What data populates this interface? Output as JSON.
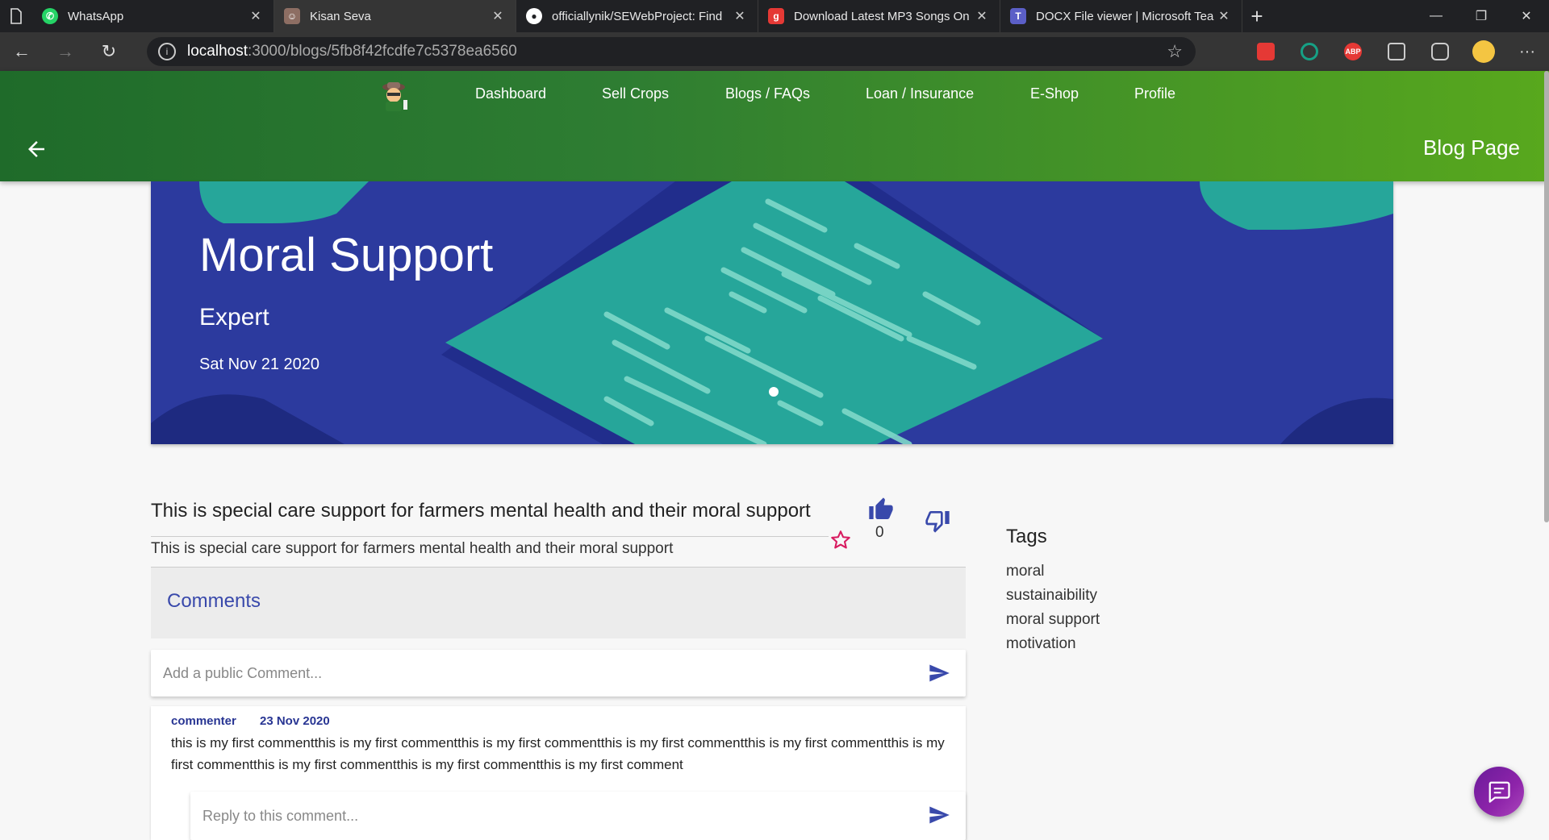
{
  "browser": {
    "tabs": [
      {
        "title": "WhatsApp",
        "icon": "whatsapp-icon",
        "color": "#25d366"
      },
      {
        "title": "Kisan Seva",
        "icon": "kisan-seva-favicon",
        "color": "#8d6e63"
      },
      {
        "title": "officiallynik/SEWebProject: Find",
        "icon": "github-icon",
        "color": "#ffffff"
      },
      {
        "title": "Download Latest MP3 Songs On",
        "icon": "gaana-icon",
        "color": "#e53935"
      },
      {
        "title": "DOCX File viewer | Microsoft Tea",
        "icon": "teams-icon",
        "color": "#5b5fc7"
      }
    ],
    "url_host": "localhost",
    "url_path": ":3000/blogs/5fb8f42fcdfe7c5378ea6560",
    "extensions": [
      {
        "name": "screenshot-ext-icon",
        "label": "",
        "color": "#e53935"
      },
      {
        "name": "circle-ext-icon",
        "label": "",
        "color": "#16a085"
      },
      {
        "name": "adblock-icon",
        "label": "ABP",
        "color": "#e53935"
      },
      {
        "name": "collections-icon",
        "label": "",
        "color": "#555555"
      },
      {
        "name": "camera-ext-icon",
        "label": "",
        "color": "#555555"
      },
      {
        "name": "profile-avatar-icon",
        "label": "",
        "color": "#f4c542"
      }
    ]
  },
  "nav": {
    "items": [
      "Dashboard",
      "Sell Crops",
      "Blogs / FAQs",
      "Loan / Insurance",
      "E-Shop",
      "Profile"
    ],
    "page_label": "Blog Page"
  },
  "hero": {
    "title": "Moral Support",
    "subtitle": "Expert",
    "date": "Sat Nov 21 2020"
  },
  "post": {
    "title": "This is special care support for farmers mental health and their moral support",
    "body": "This is special care support for farmers mental health and their moral support",
    "likes": "0"
  },
  "comments": {
    "heading": "Comments",
    "placeholder": "Add a public Comment...",
    "reply_placeholder": "Reply to this comment...",
    "items": [
      {
        "author": "commenter",
        "date": "23 Nov 2020",
        "text": "this is my first commentthis is my first commentthis is my first commentthis is my first commentthis is my first commentthis is my first commentthis is my first commentthis is my first commentthis is my first comment"
      }
    ]
  },
  "tags": {
    "title": "Tags",
    "items": [
      "moral",
      "sustainaibility",
      "moral support",
      "motivation"
    ]
  },
  "colors": {
    "header_start": "#1f6b2a",
    "header_end": "#58a81d",
    "hero_bg": "#283593",
    "accent": "#3949ab",
    "chat_fab": "#8e24aa"
  }
}
